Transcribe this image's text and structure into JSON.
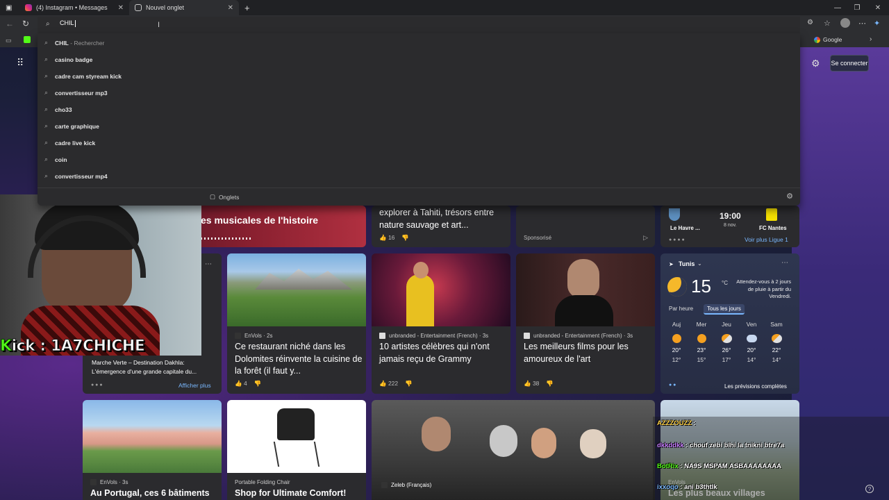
{
  "tabs": [
    {
      "label": "(4) Instagram • Messages",
      "icon": "instagram-icon"
    },
    {
      "label": "Nouvel onglet",
      "icon": "new-tab-icon"
    }
  ],
  "omnibox": {
    "value": "CHIL"
  },
  "suggestions": [
    {
      "text": "CHIL",
      "hint": " - Rechercher"
    },
    {
      "text": "casino badge",
      "hint": ""
    },
    {
      "text": "cadre cam styream kick",
      "hint": ""
    },
    {
      "text": "convertisseur mp3",
      "hint": ""
    },
    {
      "text": "cho33",
      "hint": ""
    },
    {
      "text": "carte graphique",
      "hint": ""
    },
    {
      "text": "cadre live kick",
      "hint": ""
    },
    {
      "text": "coin",
      "hint": ""
    },
    {
      "text": "convertisseur mp4",
      "hint": ""
    }
  ],
  "dropdown_footer": {
    "tabs_label": "Onglets"
  },
  "bookmarks": {
    "google": "Google"
  },
  "header": {
    "signin": "Se connecter"
  },
  "cards": {
    "hero_title": "es musicales de l'histoire",
    "tahiti": {
      "title": "explorer à Tahiti, trésors entre nature sauvage et art...",
      "likes": "16"
    },
    "sponsored": {
      "label": "Sponsorisé"
    },
    "football": {
      "home": "Le Havre ...",
      "away": "FC Nantes",
      "time": "19:00",
      "date": "8 nov.",
      "more": "Voir plus Ligue 1"
    },
    "dakhla": {
      "title": "Marche Verte – Destination Dakhla: L'émergence d'une grande capitale du...",
      "more": "Afficher plus"
    },
    "dolomites": {
      "source": "EnVols · 2s",
      "title": "Ce restaurant niché dans les Dolomites réinvente la cuisine de la forêt (il faut y...",
      "likes": "4"
    },
    "grammy": {
      "source": "unbranded - Entertainment (French) · 3s",
      "title": "10 artistes célèbres qui n'ont jamais reçu de Grammy",
      "likes": "222"
    },
    "films": {
      "source": "unbranded - Entertainment (French) · 3s",
      "title": "Les meilleurs films pour les amoureux de l'art",
      "likes": "38"
    },
    "portugal": {
      "source": "EnVols · 3s",
      "title": "Au Portugal, ces 6 bâtiments"
    },
    "chair": {
      "source": "Portable Folding Chair",
      "title": "Shop for Ultimate Comfort!"
    },
    "zeleb": {
      "source": "Zeleb (Français)"
    },
    "villages": {
      "source": "EnVols",
      "title": "Les plus beaux villages"
    }
  },
  "weather": {
    "city": "Tunis",
    "temp": "15",
    "unit": "°C",
    "alert": "Attendez-vous à 2 jours de pluie à partir du Vendredi.",
    "tab_hourly": "Par heure",
    "tab_daily": "Tous les jours",
    "link": "Les prévisions complètes",
    "days": [
      {
        "name": "Auj",
        "hi": "20°",
        "lo": "12°",
        "icon": "sun-icon"
      },
      {
        "name": "Mer",
        "hi": "23°",
        "lo": "15°",
        "icon": "sun-icon"
      },
      {
        "name": "Jeu",
        "hi": "26°",
        "lo": "17°",
        "icon": "partly-cloudy-icon"
      },
      {
        "name": "Ven",
        "hi": "20°",
        "lo": "14°",
        "icon": "rain-icon"
      },
      {
        "name": "Sam",
        "hi": "22°",
        "lo": "14°",
        "icon": "partly-cloudy-icon"
      }
    ]
  },
  "overlay": {
    "kick_prefix": "K",
    "kick_text": "ick : 1A7CHICHE",
    "chat": [
      {
        "user": "AZZZOUZZ",
        "sep": " :",
        "msg": "",
        "color": "#ffd24a"
      },
      {
        "user": "dkkddkk",
        "sep": " : ",
        "msg": "chouf zebi blhi la tnikni btre7a",
        "color": "#c77dff"
      },
      {
        "user": "BotRix",
        "sep": " : ",
        "msg": "NA9S MSPAM ASBAAAAAAAA",
        "color": "#53fc18"
      },
      {
        "user": "ixxoqo",
        "sep": " : ",
        "msg": "ani b3thtlk",
        "color": "#7ab8ff"
      }
    ]
  }
}
